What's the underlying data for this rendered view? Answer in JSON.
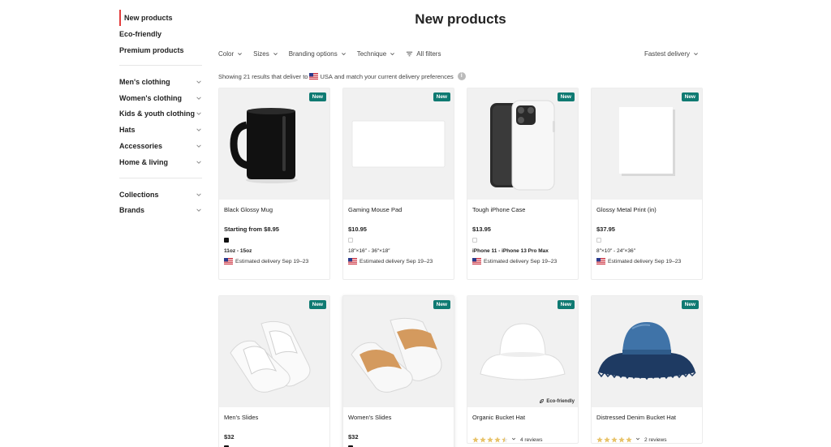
{
  "sidebar": {
    "top_items": [
      "New products",
      "Eco-friendly",
      "Premium products"
    ],
    "categories": [
      "Men's clothing",
      "Women's clothing",
      "Kids & youth clothing",
      "Hats",
      "Accessories",
      "Home & living"
    ],
    "bottom_items": [
      "Collections",
      "Brands"
    ]
  },
  "page": {
    "title": "New products"
  },
  "filters": {
    "color": "Color",
    "sizes": "Sizes",
    "branding": "Branding options",
    "technique": "Technique",
    "all": "All filters",
    "sort": "Fastest delivery"
  },
  "results": {
    "prefix": "Showing 21 results that deliver to",
    "country": "USA",
    "suffix": "and match your current delivery preferences",
    "info": "i"
  },
  "badge_label": "New",
  "eco_label": "Eco-friendly",
  "products": [
    {
      "name": "Black Glossy Mug",
      "price": "Starting from $8.95",
      "size": "11oz - 15oz",
      "delivery": "Estimated delivery Sep 19–23"
    },
    {
      "name": "Gaming Mouse Pad",
      "price": "$10.95",
      "size": "18″×16″ - 36″×18″",
      "delivery": "Estimated delivery Sep 19–23"
    },
    {
      "name": "Tough iPhone Case",
      "price": "$13.95",
      "size": "iPhone 11 - iPhone 13 Pro Max",
      "delivery": "Estimated delivery Sep 19–23"
    },
    {
      "name": "Glossy Metal Print (in)",
      "price": "$37.95",
      "size": "8″×10″ - 24″×36″",
      "delivery": "Estimated delivery Sep 19–23"
    },
    {
      "name": "Men's Slides",
      "price": "$32"
    },
    {
      "name": "Women's Slides",
      "price": "$32"
    },
    {
      "name": "Organic Bucket Hat",
      "rating": 4.5,
      "reviews": "4 reviews"
    },
    {
      "name": "Distressed Denim Bucket Hat",
      "rating": 5,
      "reviews": "2 reviews"
    }
  ],
  "colors": {
    "accent_red": "#e23d3d",
    "badge_teal": "#0f7a72",
    "star_gold": "#e8c36a"
  },
  "icons": [
    "chevron-down-icon",
    "filter-icon",
    "info-icon",
    "us-flag-icon",
    "star-icon",
    "leaf-icon"
  ]
}
